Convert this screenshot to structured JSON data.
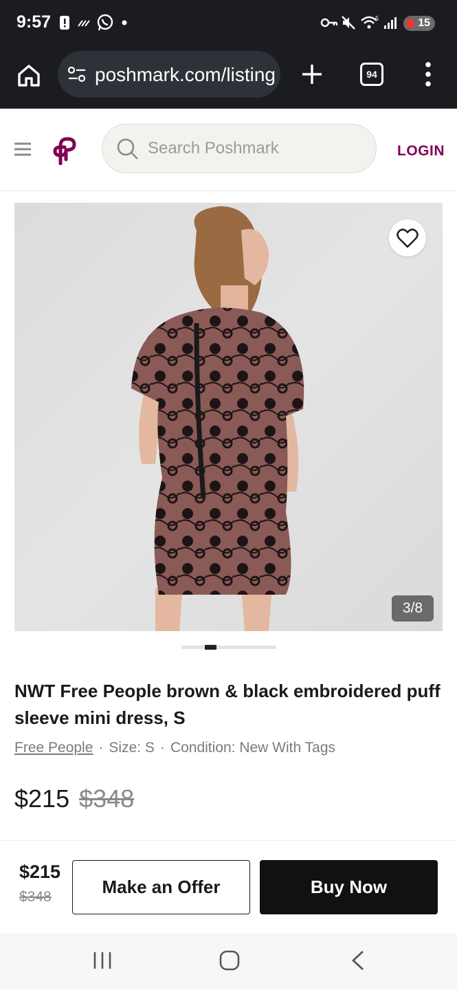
{
  "status_bar": {
    "time": "9:57",
    "battery": "15",
    "icons": [
      "alert-icon",
      "signal-lines-icon",
      "whatsapp-icon",
      "dot-icon",
      "key-icon",
      "mute-icon",
      "wifi-icon",
      "cell-signal-icon",
      "battery-icon"
    ]
  },
  "browser": {
    "url": "poshmark.com/listing",
    "tab_count": "94",
    "icons": [
      "home-icon",
      "site-settings-icon",
      "plus-icon",
      "tabs-icon",
      "more-vert-icon"
    ]
  },
  "header": {
    "search_placeholder": "Search Poshmark",
    "login_label": "LOGIN",
    "brand_color": "#7f0353"
  },
  "listing": {
    "image_counter": "3/8",
    "image_index": 3,
    "image_total": 8,
    "title": "NWT Free People brown & black embroidered puff sleeve mini dress, S",
    "brand": "Free People",
    "size": "Size: S",
    "condition": "Condition: New With Tags",
    "separator": "·",
    "price": "$215",
    "original_price": "$348"
  },
  "action_bar": {
    "price": "$215",
    "original_price": "$348",
    "offer_label": "Make an Offer",
    "buy_label": "Buy Now"
  },
  "nav_bar": {
    "icons": [
      "recent-apps-icon",
      "home-nav-icon",
      "back-icon"
    ]
  }
}
